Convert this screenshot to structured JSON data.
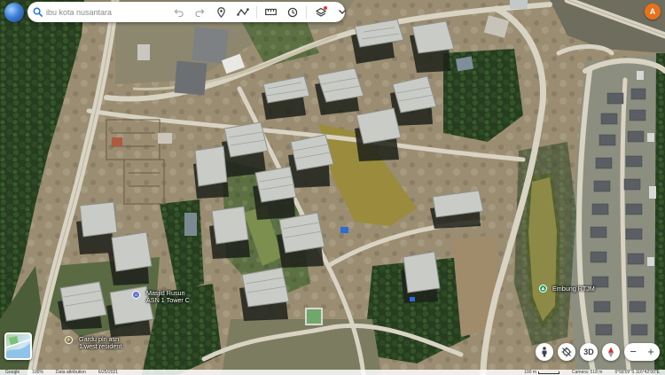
{
  "search": {
    "placeholder": "ibu kota nusantara"
  },
  "toolbar": {
    "icons": [
      "search-icon",
      "undo-icon",
      "redo-icon",
      "pin-icon",
      "path-icon",
      "ruler-icon",
      "history-icon",
      "layers-icon",
      "chevron-down-icon"
    ]
  },
  "user": {
    "initial": "A",
    "color": "#e8711a"
  },
  "labels": {
    "masjid": "Masjid Rusun\nASN 1 Tower C",
    "gardu": "Gardu pln asn\n1 west resident",
    "embung": "Embung RTJM"
  },
  "controls": {
    "threeD": "3D",
    "zoom_out": "−",
    "zoom_in": "+"
  },
  "footer": {
    "brand": "Google",
    "zoom": "100%",
    "data_attribution": "Data attribution",
    "date": "6/25/2021",
    "scale_label": "100 m",
    "camera": "Camera: 518 m",
    "coords": "0°58'09\"S 116°42'00\"E"
  },
  "colors": {
    "accent": "#1a73e8",
    "water": "#8f8a3f",
    "vegetation": "#2f4a22"
  }
}
